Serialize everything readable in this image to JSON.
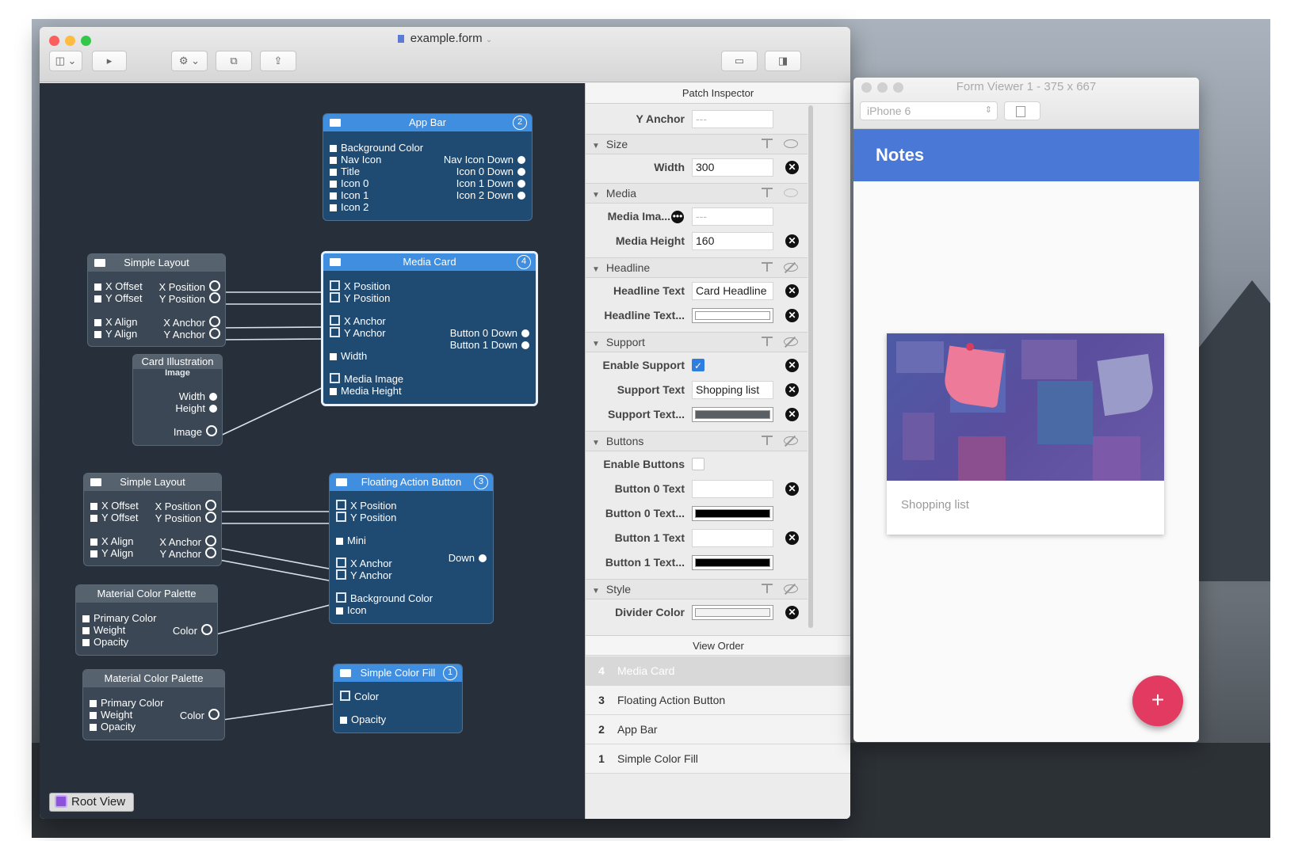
{
  "window": {
    "title": "example.form"
  },
  "canvas": {
    "root_view_label": "Root View",
    "nodes": {
      "app_bar": {
        "title": "App Bar",
        "num": "2",
        "inputs": [
          "Background Color",
          "Nav Icon",
          "Title",
          "Icon 0",
          "Icon 1",
          "Icon 2"
        ],
        "outputs": [
          "Nav Icon Down",
          "Icon 0 Down",
          "Icon 1 Down",
          "Icon 2 Down"
        ]
      },
      "simple_layout_1": {
        "title": "Simple Layout",
        "inputs": [
          "X Offset",
          "Y Offset",
          "X Align",
          "Y Align"
        ],
        "outputs": [
          "X Position",
          "Y Position",
          "X Anchor",
          "Y Anchor"
        ]
      },
      "media_card": {
        "title": "Media Card",
        "num": "4",
        "inputs": [
          "X Position",
          "Y Position",
          "X Anchor",
          "Y Anchor",
          "Width",
          "Media Image",
          "Media Height"
        ],
        "outputs": [
          "Button 0 Down",
          "Button 1 Down"
        ]
      },
      "card_illustration": {
        "title": "Card Illustration",
        "subtitle": "Image",
        "outputs": [
          "Width",
          "Height",
          "Image"
        ]
      },
      "simple_layout_2": {
        "title": "Simple Layout",
        "inputs": [
          "X Offset",
          "Y Offset",
          "X Align",
          "Y Align"
        ],
        "outputs": [
          "X Position",
          "Y Position",
          "X Anchor",
          "Y Anchor"
        ]
      },
      "fab": {
        "title": "Floating Action Button",
        "num": "3",
        "inputs": [
          "X Position",
          "Y Position",
          "Mini",
          "X Anchor",
          "Y Anchor",
          "Background Color",
          "Icon"
        ],
        "outputs": [
          "Down"
        ]
      },
      "palette_1": {
        "title": "Material Color Palette",
        "inputs": [
          "Primary Color",
          "Weight",
          "Opacity"
        ],
        "outputs": [
          "Color"
        ]
      },
      "palette_2": {
        "title": "Material Color Palette",
        "inputs": [
          "Primary Color",
          "Weight",
          "Opacity"
        ],
        "outputs": [
          "Color"
        ]
      },
      "color_fill": {
        "title": "Simple Color Fill",
        "num": "1",
        "inputs": [
          "Color",
          "Opacity"
        ]
      }
    }
  },
  "inspector": {
    "title": "Patch Inspector",
    "y_anchor": {
      "label": "Y Anchor",
      "value": "---"
    },
    "sections": {
      "size": "Size",
      "media": "Media",
      "headline": "Headline",
      "support": "Support",
      "buttons": "Buttons",
      "style": "Style"
    },
    "width": {
      "label": "Width",
      "value": "300"
    },
    "media_image": {
      "label": "Media Ima...",
      "value": "---"
    },
    "media_height": {
      "label": "Media Height",
      "value": "160"
    },
    "headline_text": {
      "label": "Headline Text",
      "value": "Card Headline"
    },
    "headline_color": {
      "label": "Headline Text...",
      "color": "#ffffff"
    },
    "enable_support": {
      "label": "Enable Support",
      "checked": true
    },
    "support_text": {
      "label": "Support Text",
      "value": "Shopping list"
    },
    "support_color": {
      "label": "Support Text...",
      "color": "#5a5f66"
    },
    "enable_buttons": {
      "label": "Enable Buttons",
      "checked": false
    },
    "button0_text": {
      "label": "Button 0 Text",
      "value": ""
    },
    "button0_color": {
      "label": "Button 0 Text...",
      "color": "#000000"
    },
    "button1_text": {
      "label": "Button 1 Text",
      "value": ""
    },
    "button1_color": {
      "label": "Button 1 Text...",
      "color": "#000000"
    },
    "divider_color": {
      "label": "Divider Color",
      "color": "#f2f2f2"
    }
  },
  "view_order": {
    "title": "View Order",
    "items": [
      {
        "num": "4",
        "label": "Media Card",
        "selected": true
      },
      {
        "num": "3",
        "label": "Floating Action Button"
      },
      {
        "num": "2",
        "label": "App Bar"
      },
      {
        "num": "1",
        "label": "Simple Color Fill"
      }
    ]
  },
  "viewer": {
    "title": "Form Viewer 1 - 375 x 667",
    "device": "iPhone 6",
    "app_title": "Notes",
    "card_support_text": "Shopping list",
    "fab_icon": "+",
    "colors": {
      "app_bar": "#4a78d6",
      "fab": "#e23a61"
    }
  }
}
